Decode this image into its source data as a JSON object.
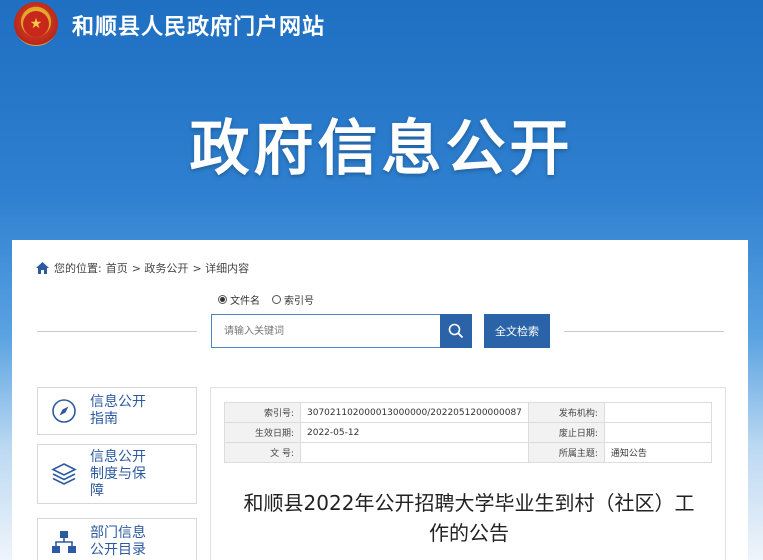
{
  "header": {
    "emblem_glyph": "★",
    "site_title": "和顺县人民政府门户网站"
  },
  "banner": {
    "title": "政府信息公开"
  },
  "breadcrumb": {
    "prefix": "您的位置:",
    "items": [
      "首页",
      "> 政务公开",
      "> 详细内容"
    ]
  },
  "search": {
    "options": [
      {
        "label": "文件名",
        "selected": true
      },
      {
        "label": "索引号",
        "selected": false
      }
    ],
    "placeholder": "请输入关键词",
    "fulltext_label": "全文检索"
  },
  "sidebar": {
    "items": [
      {
        "label_line1": "信息公开",
        "label_line2": "指南",
        "label_line3": ""
      },
      {
        "label_line1": "信息公开",
        "label_line2": "制度与保",
        "label_line3": "障"
      },
      {
        "label_line1": "部门信息",
        "label_line2": "公开目录",
        "label_line3": ""
      }
    ]
  },
  "meta": {
    "index_label": "索引号:",
    "index_value": "307021102000013000000/2022051200000087",
    "publisher_label": "发布机构:",
    "publisher_value": "",
    "effective_label": "生效日期:",
    "effective_value": "2022-05-12",
    "expire_label": "废止日期:",
    "expire_value": "",
    "docno_label": "文 号:",
    "docno_value": "",
    "topic_label": "所属主题:",
    "topic_value": "通知公告"
  },
  "article": {
    "title": "和顺县2022年公开招聘大学毕业生到村（社区）工作的公告"
  },
  "colors": {
    "primary": "#2b63a8",
    "link": "#2c5aa0"
  }
}
